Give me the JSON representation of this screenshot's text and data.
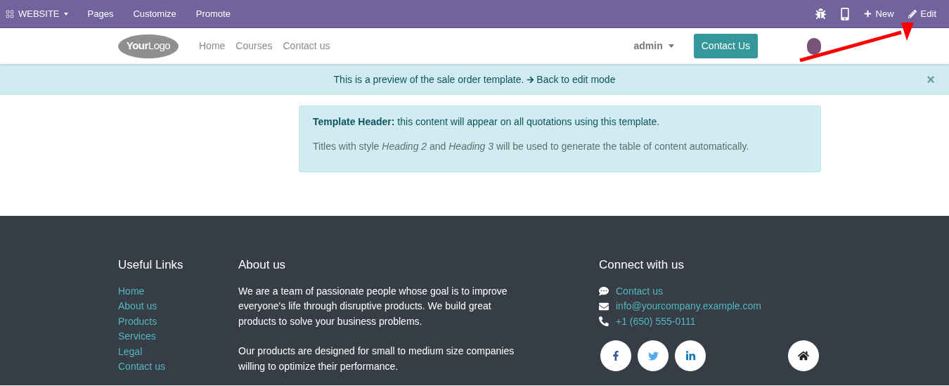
{
  "admin_bar": {
    "app_menu": "WEBSITE",
    "menus": [
      "Pages",
      "Customize",
      "Promote"
    ],
    "new_label": "New",
    "edit_label": "Edit"
  },
  "header": {
    "logo": {
      "bold": "Your",
      "light": "Logo"
    },
    "nav": [
      "Home",
      "Courses",
      "Contact us"
    ],
    "user": "admin",
    "cta": "Contact Us"
  },
  "preview_alert": {
    "text": "This is a preview of the sale order template.",
    "link": "Back to edit mode",
    "close": "×"
  },
  "template_card": {
    "lines": [
      "**Template Header:** this content will appear on all quotations using this template.",
      "Titles with style *Heading 2* and *Heading 3* will be used to generate the table of content automatically."
    ]
  },
  "footer": {
    "useful_links": {
      "title": "Useful Links",
      "links": [
        "Home",
        "About us",
        "Products",
        "Services",
        "Legal",
        "Contact us"
      ]
    },
    "about": {
      "title": "About us",
      "paragraphs": [
        "We are a team of passionate people whose goal is to improve everyone's life through disruptive products. We build great products to solve your business problems.",
        "Our products are designed for small to medium size companies willing to optimize their performance."
      ]
    },
    "connect": {
      "title": "Connect with us",
      "items": [
        {
          "kind": "chat",
          "text": "Contact us"
        },
        {
          "kind": "mail",
          "text": "info@yourcompany.example.com"
        },
        {
          "kind": "phone",
          "text": "+1 (650) 555-0111"
        }
      ],
      "social": [
        {
          "kind": "facebook"
        },
        {
          "kind": "twitter"
        },
        {
          "kind": "linkedin"
        },
        {
          "kind": "home"
        }
      ]
    }
  }
}
